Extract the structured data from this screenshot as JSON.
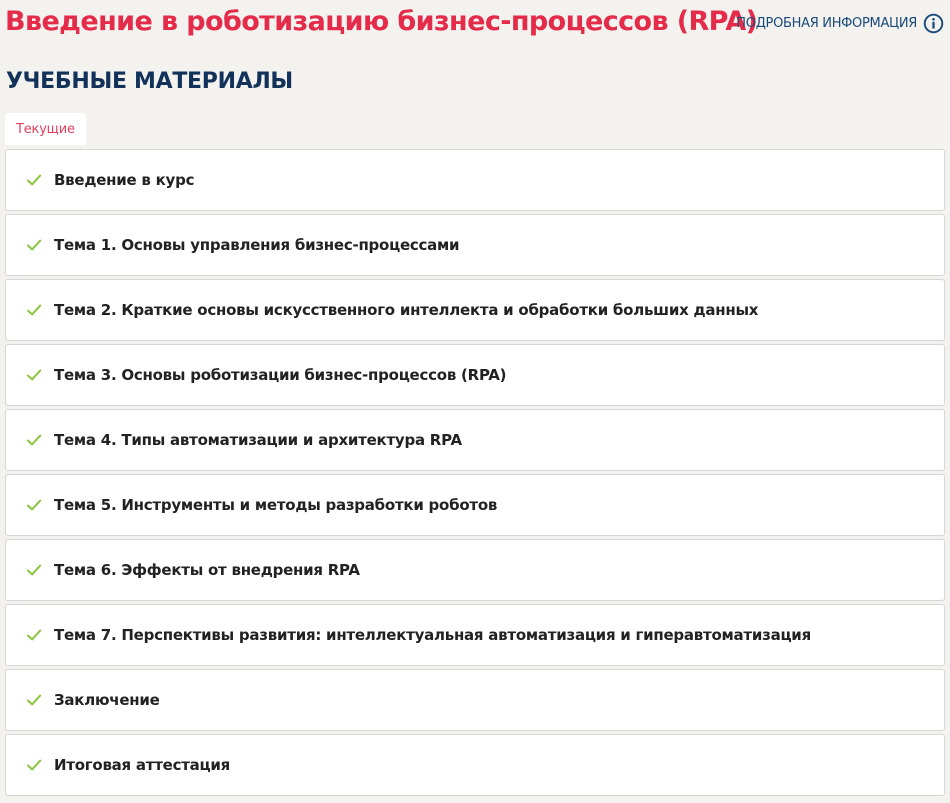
{
  "header": {
    "course_title": "Введение в роботизацию бизнес-процессов (RPA)",
    "details_label": "ПОДРОБНАЯ ИНФОРМАЦИЯ",
    "details_icon": "info-circle-icon"
  },
  "section": {
    "heading": "УЧЕБНЫЕ МАТЕРИАЛЫ"
  },
  "tabs": [
    {
      "label": "Текущие",
      "active": true
    }
  ],
  "materials": [
    {
      "label": "Введение в курс",
      "completed": true
    },
    {
      "label": "Тема 1. Основы управления бизнес-процессами",
      "completed": true
    },
    {
      "label": "Тема 2. Краткие основы искусственного интеллекта и обработки больших данных",
      "completed": true
    },
    {
      "label": "Тема 3. Основы роботизации бизнес-процессов (RPA)",
      "completed": true
    },
    {
      "label": "Тема 4. Типы автоматизации и архитектура RPA",
      "completed": true
    },
    {
      "label": "Тема 5. Инструменты и методы разработки роботов",
      "completed": true
    },
    {
      "label": "Тема 6. Эффекты от внедрения RPA",
      "completed": true
    },
    {
      "label": "Тема 7. Перспективы развития: интеллектуальная автоматизация и гиперавтоматизация",
      "completed": true
    },
    {
      "label": "Заключение",
      "completed": true
    },
    {
      "label": "Итоговая аттестация",
      "completed": true
    }
  ],
  "colors": {
    "title_red": "#e52b4a",
    "heading_navy": "#13325a",
    "link_blue": "#1b4a7a",
    "tab_text": "#e0405e",
    "check_green": "#8cc63f",
    "page_background": "#f3f2ef",
    "card_background": "#ffffff",
    "card_border": "#d6d6d6"
  }
}
